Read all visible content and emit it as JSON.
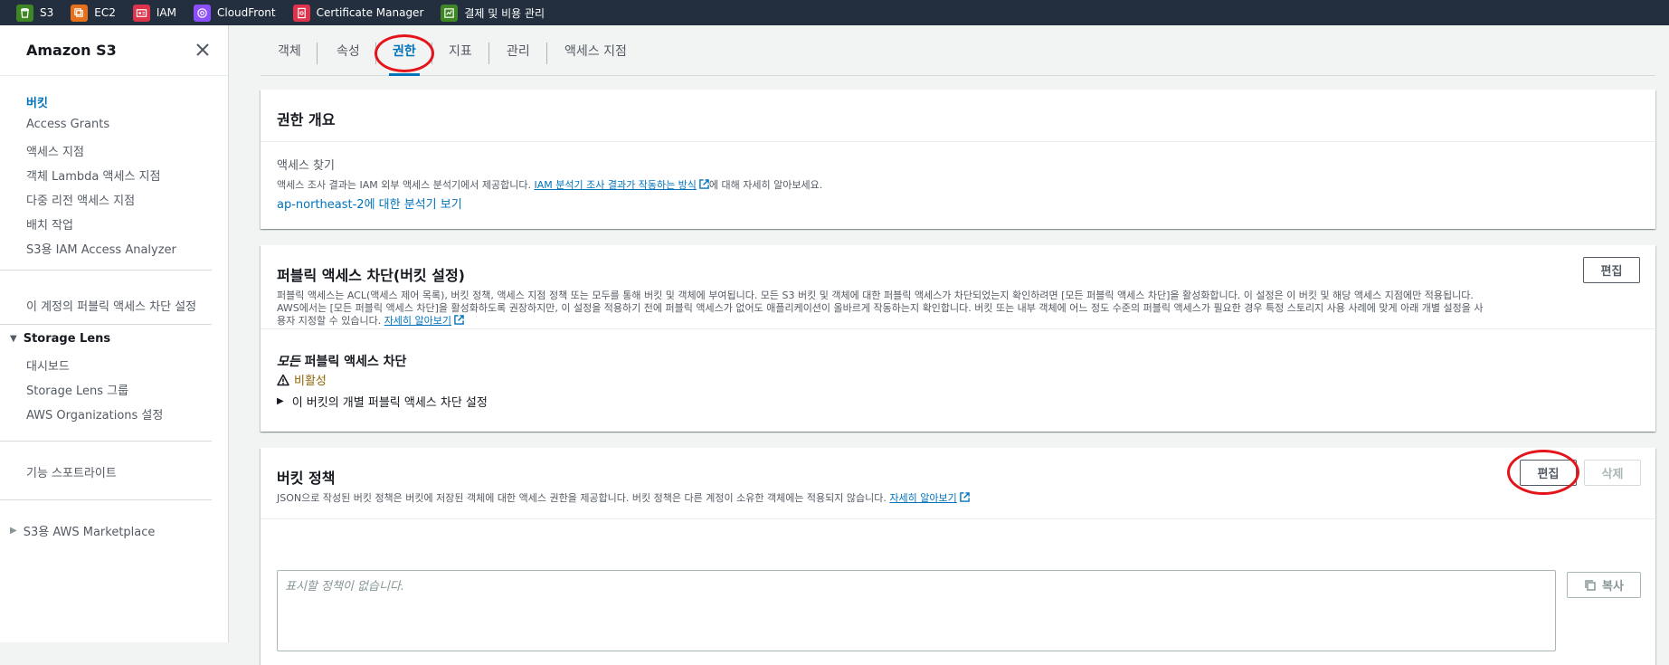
{
  "favorites": [
    {
      "label": "S3",
      "icon": "s3-icon",
      "color": "#3f8624"
    },
    {
      "label": "EC2",
      "icon": "ec2-icon",
      "color": "#e7711b"
    },
    {
      "label": "IAM",
      "icon": "iam-icon",
      "color": "#dd344c"
    },
    {
      "label": "CloudFront",
      "icon": "cloudfront-icon",
      "color": "#8c4fff"
    },
    {
      "label": "Certificate Manager",
      "icon": "certificate-manager-icon",
      "color": "#dd344c"
    },
    {
      "label": "결제 및 비용 관리",
      "icon": "billing-icon",
      "color": "#3f8624"
    }
  ],
  "sidebar": {
    "title": "Amazon S3",
    "items": [
      {
        "label": "버킷"
      },
      {
        "label": "Access Grants"
      },
      {
        "label": "액세스 지점"
      },
      {
        "label": "객체 Lambda 액세스 지점"
      },
      {
        "label": "다중 리전 액세스 지점"
      },
      {
        "label": "배치 작업"
      },
      {
        "label": "S3용 IAM Access Analyzer"
      }
    ],
    "account_block_public": "이 계정의 퍼블릭 액세스 차단 설정",
    "storage_lens": {
      "title": "Storage Lens",
      "items": [
        "대시보드",
        "Storage Lens 그룹",
        "AWS Organizations 설정"
      ]
    },
    "feature_spotlight": "기능 스포트라이트",
    "marketplace": "S3용 AWS Marketplace"
  },
  "tabs": [
    {
      "label": "객체"
    },
    {
      "label": "속성"
    },
    {
      "label": "권한"
    },
    {
      "label": "지표"
    },
    {
      "label": "관리"
    },
    {
      "label": "액세스 지점"
    }
  ],
  "overview": {
    "title": "권한 개요",
    "access_finding_label": "액세스 찾기",
    "desc_prefix": "액세스 조사 결과는 IAM 외부 액세스 분석기에서 제공합니다. ",
    "desc_link": "IAM 분석기 조사 결과가 작동하는 방식",
    "desc_suffix": "에 대해 자세히 알아보세요.",
    "analyzer_link": "ap-northeast-2에 대한 분석기 보기"
  },
  "block_public": {
    "title": "퍼블릭 액세스 차단(버킷 설정)",
    "edit_label": "편집",
    "desc": "퍼블릭 액세스는 ACL(액세스 제어 목록), 버킷 정책, 액세스 지점 정책 또는 모두를 통해 버킷 및 객체에 부여됩니다. 모든 S3 버킷 및 객체에 대한 퍼블릭 액세스가 차단되었는지 확인하려면 [모든 퍼블릭 액세스 차단]을 활성화합니다. 이 설정은 이 버킷 및 해당 액세스 지점에만 적용됩니다. AWS에서는 [모든 퍼블릭 액세스 차단]을 활성화하도록 권장하지만, 이 설정을 적용하기 전에 퍼블릭 액세스가 없어도 애플리케이션이 올바르게 작동하는지 확인합니다. 버킷 또는 내부 객체에 어느 정도 수준의 퍼블릭 액세스가 필요한 경우 특정 스토리지 사용 사례에 맞게 아래 개별 설정을 사용자 지정할 수 있습니다.",
    "learn_more": "자세히 알아보기",
    "setting_title_em": "모든",
    "setting_title_rest": " 퍼블릭 액세스 차단",
    "status": "비활성",
    "expander": "이 버킷의 개별 퍼블릭 액세스 차단 설정"
  },
  "bucket_policy": {
    "title": "버킷 정책",
    "edit_label": "편집",
    "delete_label": "삭제",
    "desc": "JSON으로 작성된 버킷 정책은 버킷에 저장된 객체에 대한 액세스 권한을 제공합니다. 버킷 정책은 다른 계정이 소유한 객체에는 적용되지 않습니다. ",
    "learn_more": "자세히 알아보기",
    "placeholder": "표시할 정책이 없습니다.",
    "copy_label": "복사"
  },
  "colors": {
    "accent": "#0073bb",
    "warning": "#8d6605",
    "annotation": "#e3141a",
    "topbar": "#232f3e"
  }
}
